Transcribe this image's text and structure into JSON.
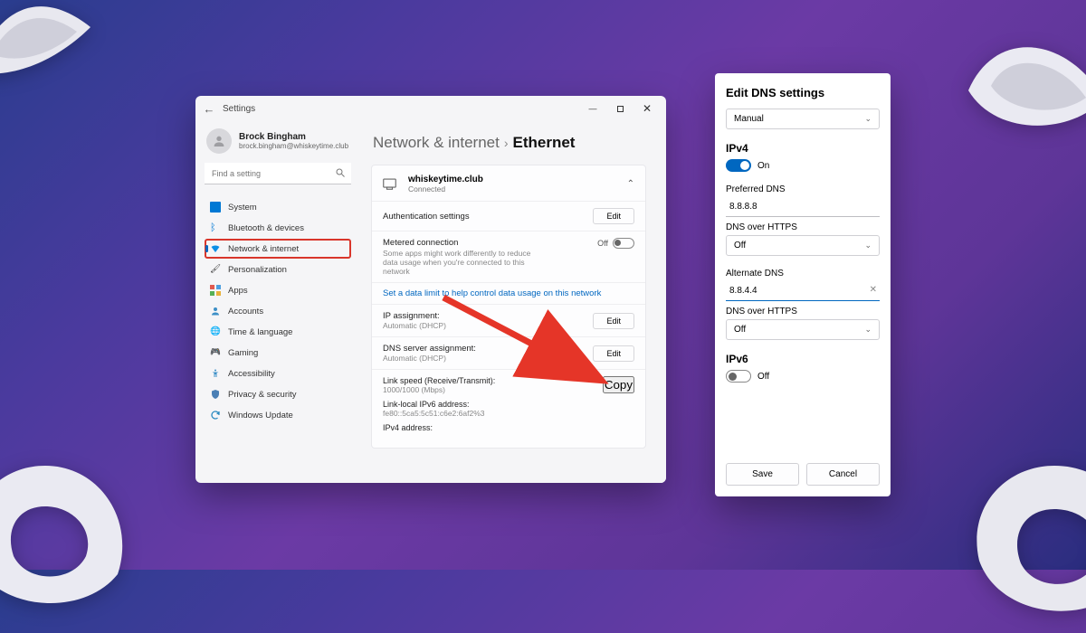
{
  "settings": {
    "title": "Settings",
    "user": {
      "name": "Brock Bingham",
      "email": "brock.bingham@whiskeytime.club"
    },
    "searchPlaceholder": "Find a setting",
    "nav": {
      "system": "System",
      "bluetooth": "Bluetooth & devices",
      "network": "Network & internet",
      "personalization": "Personalization",
      "apps": "Apps",
      "accounts": "Accounts",
      "time": "Time & language",
      "gaming": "Gaming",
      "accessibility": "Accessibility",
      "privacy": "Privacy & security",
      "update": "Windows Update"
    },
    "crumb": {
      "parent": "Network & internet",
      "current": "Ethernet"
    },
    "net": {
      "name": "whiskeytime.club",
      "status": "Connected",
      "auth": "Authentication settings",
      "metered": {
        "title": "Metered connection",
        "desc": "Some apps might work differently to reduce data usage when you're connected to this network",
        "state": "Off"
      },
      "datalimit": "Set a data limit to help control data usage on this network",
      "ip": {
        "label": "IP assignment:",
        "value": "Automatic (DHCP)"
      },
      "dns": {
        "label": "DNS server assignment:",
        "value": "Automatic (DHCP)"
      },
      "link": {
        "label": "Link speed (Receive/Transmit):",
        "value": "1000/1000 (Mbps)"
      },
      "ll6": {
        "label": "Link-local IPv6 address:",
        "value": "fe80::5ca5:5c51:c6e2:6af2%3"
      },
      "ip4": {
        "label": "IPv4 address:"
      },
      "editBtn": "Edit",
      "copyBtn": "Copy"
    }
  },
  "dlg": {
    "title": "Edit DNS settings",
    "mode": "Manual",
    "ipv4": {
      "label": "IPv4",
      "state": "On",
      "pref": {
        "label": "Preferred DNS",
        "value": "8.8.8.8"
      },
      "doh1": {
        "label": "DNS over HTTPS",
        "value": "Off"
      },
      "alt": {
        "label": "Alternate DNS",
        "value": "8.8.4.4"
      },
      "doh2": {
        "label": "DNS over HTTPS",
        "value": "Off"
      }
    },
    "ipv6": {
      "label": "IPv6",
      "state": "Off"
    },
    "save": "Save",
    "cancel": "Cancel"
  },
  "colors": {
    "accent": "#0067c0",
    "highlight": "#d9362b"
  }
}
